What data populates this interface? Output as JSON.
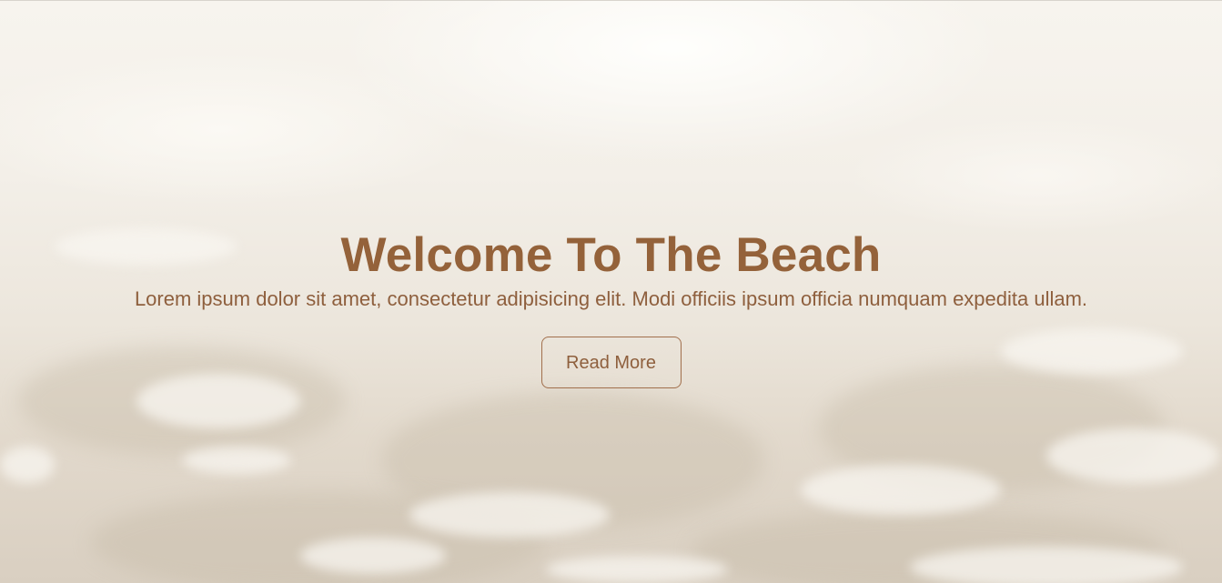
{
  "hero": {
    "title": "Welcome To The Beach",
    "subtitle": "Lorem ipsum dolor sit amet, consectetur adipisicing elit. Modi officiis ipsum officia numquam expedita ullam.",
    "button_label": "Read More"
  },
  "colors": {
    "text_brown": "#94623a",
    "button_border": "#a16f4c"
  }
}
